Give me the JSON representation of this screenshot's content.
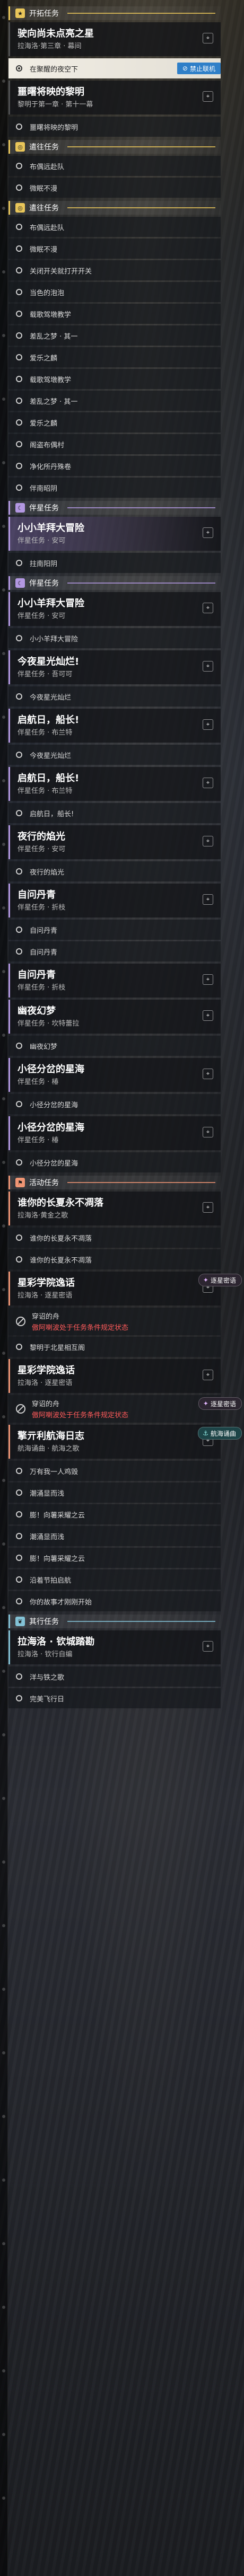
{
  "colors": {
    "story": "#e9c65a",
    "journey": "#e9c65a",
    "trail": "#b398e2",
    "event": "#ef9574",
    "side": "#83c2d6",
    "badge_blue": "#2f7fc8",
    "alert_red": "#ff5b5b"
  },
  "items": [
    {
      "kind": "section",
      "id": "story",
      "label": "开拓任务",
      "icon": "star-icon",
      "accent": "#e9c65a"
    },
    {
      "kind": "task",
      "title": "驶向尚未点亮之星",
      "sub": "拉海洛·第三章 · 幕间",
      "type": "story"
    },
    {
      "kind": "row",
      "text": "在聚醒的夜空下",
      "selected": true,
      "badge": {
        "text": "禁止联机",
        "icon": "lock-icon",
        "style": "blue"
      }
    },
    {
      "kind": "task",
      "title": "噩曙将映的黎明",
      "sub": "黎明于第一章 · 第十一幕",
      "type": "story"
    },
    {
      "kind": "row",
      "text": "噩曙将映的黎明"
    },
    {
      "kind": "section",
      "id": "journey1",
      "label": "遣往任务",
      "icon": "compass-icon",
      "accent": "#e9c65a"
    },
    {
      "kind": "row",
      "text": "布偶远赴队"
    },
    {
      "kind": "row",
      "text": "微眠不漫"
    },
    {
      "kind": "section",
      "id": "journey2",
      "label": "遣往任务",
      "icon": "compass-icon",
      "accent": "#e9c65a"
    },
    {
      "kind": "row",
      "text": "布偶远赴队"
    },
    {
      "kind": "row",
      "text": "微眠不漫"
    },
    {
      "kind": "row",
      "text": "关闭开关就打开开关"
    },
    {
      "kind": "row",
      "text": "当色的泡泡"
    },
    {
      "kind": "row",
      "text": "载歌驾墩教学"
    },
    {
      "kind": "row",
      "text": "差乱之梦 · 其一"
    },
    {
      "kind": "row",
      "text": "爱乐之麟"
    },
    {
      "kind": "row",
      "text": "载歌驾墩教学"
    },
    {
      "kind": "row",
      "text": "差乱之梦 · 其一"
    },
    {
      "kind": "row",
      "text": "爱乐之麟"
    },
    {
      "kind": "row",
      "text": "阁盗布偶村"
    },
    {
      "kind": "row",
      "text": "净化所丹殊卷"
    },
    {
      "kind": "row",
      "text": "伴南昭阴"
    },
    {
      "kind": "section",
      "id": "trail1",
      "label": "伴星任务",
      "icon": "moon-icon",
      "accent": "#b398e2"
    },
    {
      "kind": "task",
      "title": "小小羊拜大冒险",
      "sub": "伴星任务 · 安可",
      "type": "trail",
      "highlight": true
    },
    {
      "kind": "row",
      "text": "拄南阳阴"
    },
    {
      "kind": "section",
      "id": "trail2",
      "label": "伴星任务",
      "icon": "moon-icon",
      "accent": "#b398e2"
    },
    {
      "kind": "task",
      "title": "小小羊拜大冒险",
      "sub": "伴星任务 · 安可",
      "type": "trail"
    },
    {
      "kind": "row",
      "text": "小小羊拜大冒险"
    },
    {
      "kind": "task",
      "title": "今夜星光灿烂!",
      "sub": "伴星任务 · 吾可可",
      "type": "trail"
    },
    {
      "kind": "row",
      "text": "今夜星光灿烂"
    },
    {
      "kind": "task",
      "title": "启航日，船长!",
      "sub": "伴星任务 · 布兰特",
      "type": "trail"
    },
    {
      "kind": "row",
      "text": "今夜星光灿烂"
    },
    {
      "kind": "task",
      "title": "启航日，船长!",
      "sub": "伴星任务 · 布兰特",
      "type": "trail"
    },
    {
      "kind": "row",
      "text": "启航日，船长!"
    },
    {
      "kind": "task",
      "title": "夜行的焰光",
      "sub": "伴星任务 · 安可",
      "type": "trail"
    },
    {
      "kind": "row",
      "text": "夜行的焰光"
    },
    {
      "kind": "task",
      "title": "自问丹青",
      "sub": "伴星任务 · 折枝",
      "type": "trail"
    },
    {
      "kind": "row",
      "text": "自问丹青"
    },
    {
      "kind": "row",
      "text": "自问丹青"
    },
    {
      "kind": "task",
      "title": "自问丹青",
      "sub": "伴星任务 · 折枝",
      "type": "trail"
    },
    {
      "kind": "task",
      "title": "幽夜幻梦",
      "sub": "伴星任务 · 坎特蕾拉",
      "type": "trail"
    },
    {
      "kind": "row",
      "text": "幽夜幻梦"
    },
    {
      "kind": "task",
      "title": "小径分岔的星海",
      "sub": "伴星任务 · 椿",
      "type": "trail"
    },
    {
      "kind": "row",
      "text": "小径分岔的星海"
    },
    {
      "kind": "task",
      "title": "小径分岔的星海",
      "sub": "伴星任务 · 椿",
      "type": "trail"
    },
    {
      "kind": "row",
      "text": "小径分岔的星海"
    },
    {
      "kind": "section",
      "id": "event",
      "label": "活动任务",
      "icon": "flag-icon",
      "accent": "#ef9574"
    },
    {
      "kind": "task",
      "title": "谁你的长夏永不凋落",
      "sub": "拉海洛·黄金之歌",
      "type": "event"
    },
    {
      "kind": "row",
      "text": "谁你的长夏永不凋落"
    },
    {
      "kind": "row",
      "text": "谁你的长夏永不凋落"
    },
    {
      "kind": "task",
      "title": "星彩学院逸话",
      "sub": "拉海洛 · 逐星密语",
      "type": "event",
      "badge": {
        "text": "逐星密语",
        "icon": "sparkle-icon",
        "style": "purple"
      }
    },
    {
      "kind": "row",
      "alert": true,
      "text": "穿诏的舟",
      "alt": "傲阿喇波处于任务条件规定状态",
      "block": true
    },
    {
      "kind": "row",
      "text": "黎明于北星相互阁"
    },
    {
      "kind": "task",
      "title": "星彩学院逸话",
      "sub": "拉海洛 · 逐星密语",
      "type": "event"
    },
    {
      "kind": "row",
      "alert": true,
      "text": "穿诏的舟",
      "alt": "傲阿喇波处于任务条件规定状态",
      "block": true,
      "badge": {
        "text": "逐星密语",
        "icon": "sparkle-icon",
        "style": "purple"
      }
    },
    {
      "kind": "task",
      "title": "擎亓利航海日志",
      "sub": "航海诵曲 · 航海之歌",
      "type": "event",
      "badge": {
        "text": "航海诵曲",
        "icon": "anchor-icon",
        "style": "teal"
      }
    },
    {
      "kind": "row",
      "text": "万有我一人鸡毁"
    },
    {
      "kind": "row",
      "text": "潮涌显而浅"
    },
    {
      "kind": "row",
      "text": "膨！向薯采耀之云"
    },
    {
      "kind": "row",
      "text": "潮涌显而浅"
    },
    {
      "kind": "row",
      "text": "膨！向薯采耀之云"
    },
    {
      "kind": "row",
      "text": "沿着节拍启航"
    },
    {
      "kind": "row",
      "text": "你的故事才刚刚开始"
    },
    {
      "kind": "section",
      "id": "side",
      "label": "其行任务",
      "icon": "leaf-icon",
      "accent": "#83c2d6"
    },
    {
      "kind": "task",
      "title": "拉海洛 · 钦城踏勘",
      "sub": "拉海洛 · 钦行自编",
      "type": "side",
      "highlight": true
    },
    {
      "kind": "row",
      "text": "洋与铁之歌"
    },
    {
      "kind": "row",
      "text": "完美飞行日"
    }
  ]
}
